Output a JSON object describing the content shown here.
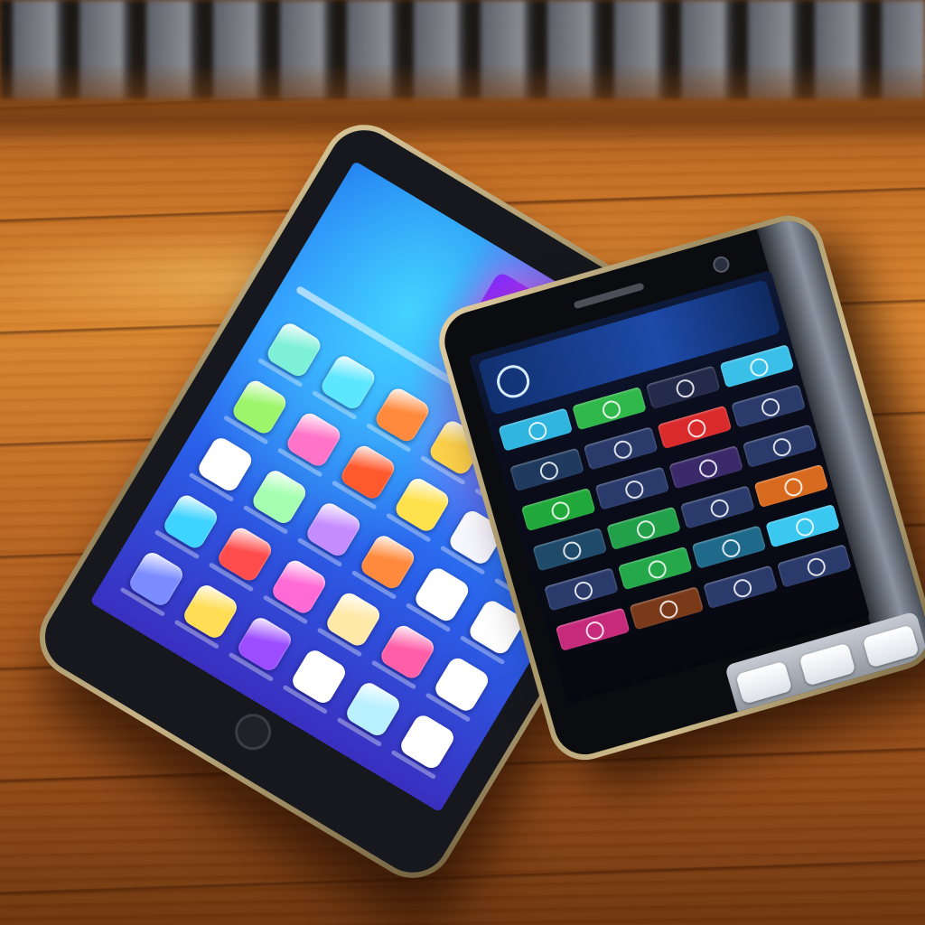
{
  "scene": {
    "description_tags": [
      "wooden-table",
      "metal-railing"
    ],
    "colors": {
      "wood": "#c06a21",
      "tablet_screen_blue": "#2f8cff",
      "phone_screen_dark": "#0a0d1c",
      "device_frame_gold": "#c7b487"
    }
  },
  "tablet": {
    "headline": "",
    "app_icons": [
      "#7ff0d8",
      "#5de7ff",
      "#ff8a3d",
      "#ffd24a",
      "#ffffff",
      "#ffffff",
      "#9cf56b",
      "#ff74c8",
      "#ff5a2e",
      "#ffe14d",
      "#f7f7ff",
      "#59c4ff",
      "#ffffff",
      "#a5ffb0",
      "#c58cff",
      "#ff8a3d",
      "#ffffff",
      "#ffffff",
      "#3fd3ff",
      "#ff4d4d",
      "#ff6ad5",
      "#ffe9a8",
      "#ff5fa8",
      "#ffffff",
      "#7b8cff",
      "#ffdd55",
      "#9b4dff",
      "#ffffff",
      "#b9f0ff",
      "#ffffff"
    ]
  },
  "phone": {
    "header_title": "",
    "header_subtitle": "",
    "tiles": [
      "#2fb5e0",
      "#31b84a",
      "#232a4a",
      "#3ac0e8",
      "#1f3a5e",
      "#2a3a6a",
      "#d92b2b",
      "#2a3a6a",
      "#21a83a",
      "#2a3a6a",
      "#3a2a6a",
      "#2a3a6a",
      "#1f4a6a",
      "#22a04a",
      "#2a3a6a",
      "#d86a20",
      "#2a3a6a",
      "#24a84a",
      "#1f6a8a",
      "#3ac8f0",
      "#c62a7a",
      "#7a3a1a",
      "#2a3a6a",
      "#2a3a6a"
    ],
    "bottom_labels": [
      "",
      "",
      ""
    ],
    "dock_buttons": 3
  }
}
